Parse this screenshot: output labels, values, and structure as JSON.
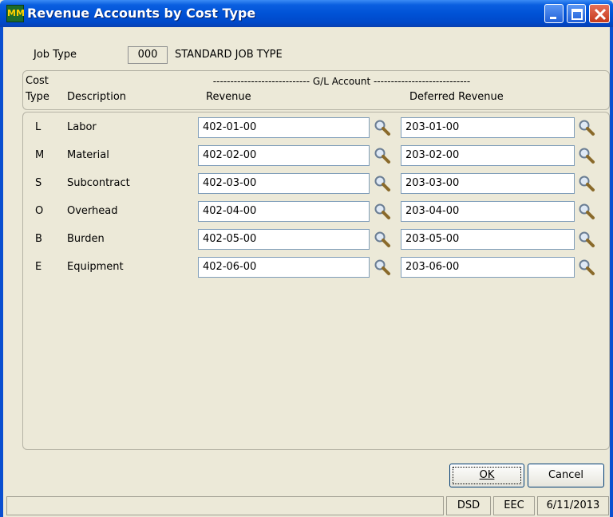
{
  "window": {
    "title": "Revenue Accounts by Cost Type",
    "icon_text": "MM",
    "controls": [
      "minimize",
      "maximize",
      "close"
    ]
  },
  "header": {
    "job_type_label": "Job Type",
    "job_type_code": "000",
    "job_type_name": "STANDARD JOB TYPE"
  },
  "columns": {
    "cost_type_line1": "Cost",
    "cost_type_line2": "Type",
    "description": "Description",
    "gl_account": "---------------------------- G/L Account ----------------------------",
    "revenue": "Revenue",
    "deferred_revenue": "Deferred Revenue"
  },
  "rows": [
    {
      "code": "L",
      "description": "Labor",
      "revenue": "402-01-00",
      "deferred": "203-01-00"
    },
    {
      "code": "M",
      "description": "Material",
      "revenue": "402-02-00",
      "deferred": "203-02-00"
    },
    {
      "code": "S",
      "description": "Subcontract",
      "revenue": "402-03-00",
      "deferred": "203-03-00"
    },
    {
      "code": "O",
      "description": "Overhead",
      "revenue": "402-04-00",
      "deferred": "203-04-00"
    },
    {
      "code": "B",
      "description": "Burden",
      "revenue": "402-05-00",
      "deferred": "203-05-00"
    },
    {
      "code": "E",
      "description": "Equipment",
      "revenue": "402-06-00",
      "deferred": "203-06-00"
    }
  ],
  "buttons": {
    "ok_label": "OK",
    "cancel_label": "Cancel"
  },
  "status": {
    "company_code": "DSD",
    "user": "EEC",
    "date": "6/11/2013"
  },
  "icons": {
    "lookup": "magnifier-icon"
  },
  "colors": {
    "titlebar": "#0052d6",
    "window_bg": "#ece9d8",
    "close_button": "#c53a1c"
  }
}
